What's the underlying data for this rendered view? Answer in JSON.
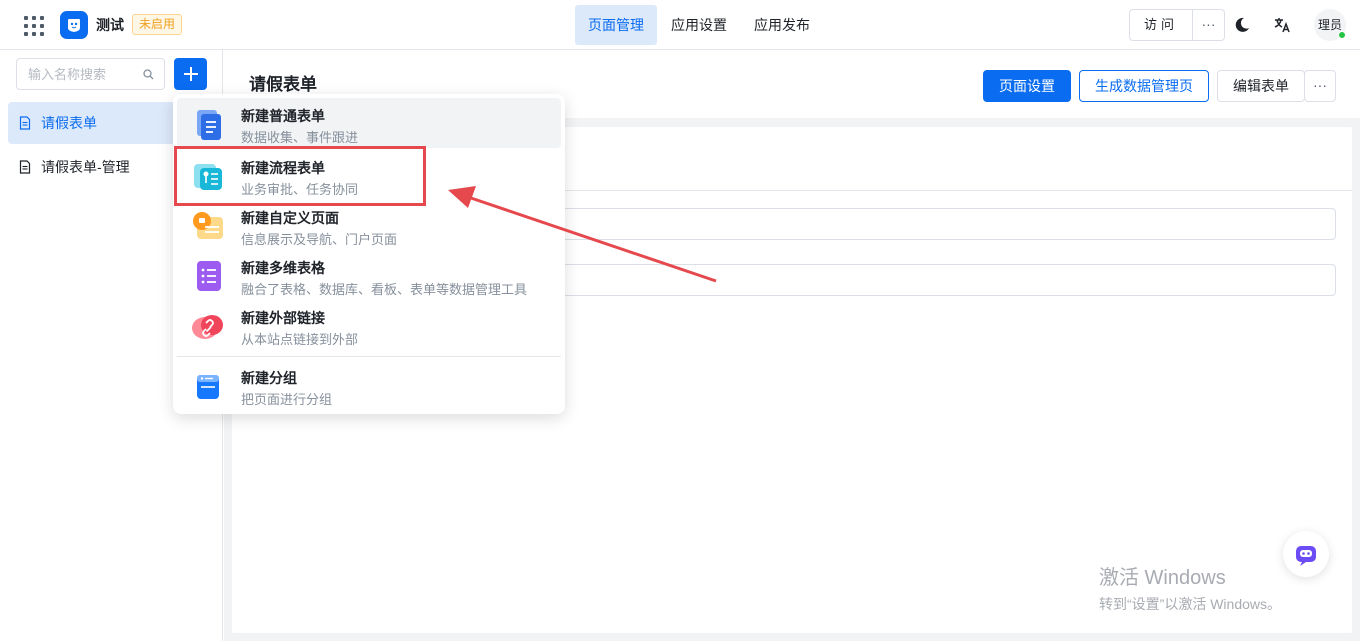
{
  "topbar": {
    "app_name": "测试",
    "app_status": "未启用",
    "tabs": [
      {
        "label": "页面管理",
        "active": true
      },
      {
        "label": "应用设置",
        "active": false
      },
      {
        "label": "应用发布",
        "active": false
      }
    ],
    "visit_label": "访问",
    "more_label": "···",
    "avatar_text": "理员"
  },
  "sidebar": {
    "search_placeholder": "输入名称搜索",
    "items": [
      {
        "label": "请假表单",
        "active": true
      },
      {
        "label": "请假表单-管理",
        "active": false
      }
    ]
  },
  "main": {
    "title": "请假表单",
    "buttons": {
      "page_settings": "页面设置",
      "generate_manage": "生成数据管理页",
      "edit_form": "编辑表单",
      "more": "···"
    }
  },
  "dropdown": {
    "items": [
      {
        "title": "新建普通表单",
        "desc": "数据收集、事件跟进",
        "icon": "form-icon"
      },
      {
        "title": "新建流程表单",
        "desc": "业务审批、任务协同",
        "icon": "process-form-icon"
      },
      {
        "title": "新建自定义页面",
        "desc": "信息展示及导航、门户页面",
        "icon": "custom-page-icon"
      },
      {
        "title": "新建多维表格",
        "desc": "融合了表格、数据库、看板、表单等数据管理工具",
        "icon": "table-icon"
      },
      {
        "title": "新建外部链接",
        "desc": "从本站点链接到外部",
        "icon": "link-icon"
      },
      {
        "title": "新建分组",
        "desc": "把页面进行分组",
        "icon": "group-icon"
      }
    ]
  },
  "watermark": {
    "title": "激活 Windows",
    "subtitle": "转到“设置”以激活 Windows。"
  },
  "colors": {
    "primary": "#0a6cf0",
    "highlight": "#e5484d",
    "status_warning": "#f0a020"
  }
}
